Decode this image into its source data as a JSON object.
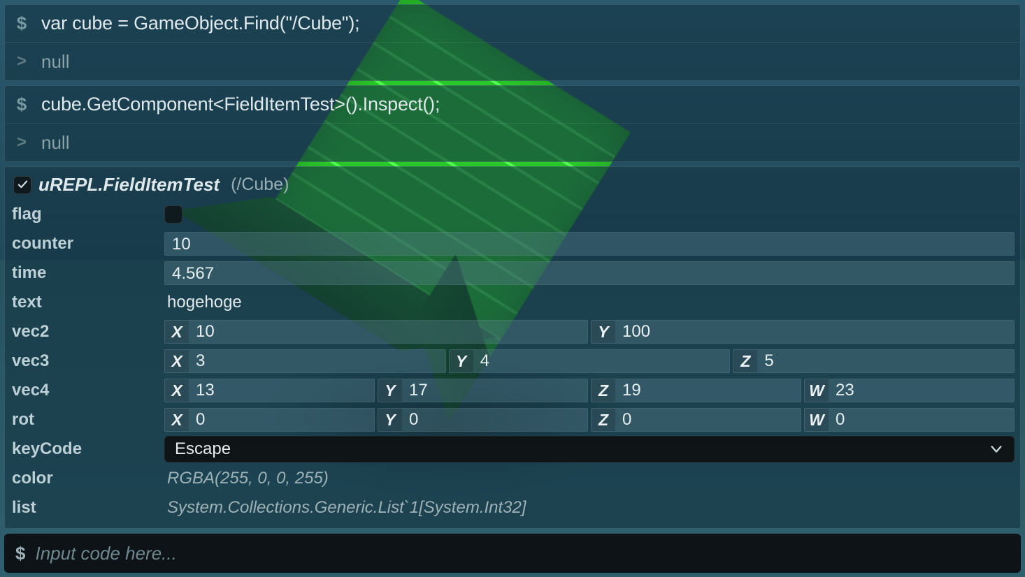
{
  "repl": {
    "entries": [
      {
        "prompt": "$",
        "cmd": "var cube = GameObject.Find(\"/Cube\");",
        "out_prompt": ">",
        "out": "null"
      },
      {
        "prompt": "$",
        "cmd": "cube.GetComponent<FieldItemTest>().Inspect();",
        "out_prompt": ">",
        "out": "null"
      }
    ]
  },
  "inspector": {
    "enabled": true,
    "title": "uREPL.FieldItemTest",
    "path": "(/Cube)",
    "fields": {
      "flag": {
        "label": "flag",
        "value": false
      },
      "counter": {
        "label": "counter",
        "value": "10"
      },
      "time": {
        "label": "time",
        "value": "4.567"
      },
      "text": {
        "label": "text",
        "value": "hogehoge"
      },
      "vec2": {
        "label": "vec2",
        "x": "10",
        "y": "100"
      },
      "vec3": {
        "label": "vec3",
        "x": "3",
        "y": "4",
        "z": "5"
      },
      "vec4": {
        "label": "vec4",
        "x": "13",
        "y": "17",
        "z": "19",
        "w": "23"
      },
      "rot": {
        "label": "rot",
        "x": "0",
        "y": "0",
        "z": "0",
        "w": "0"
      },
      "keyCode": {
        "label": "keyCode",
        "value": "Escape"
      },
      "color": {
        "label": "color",
        "value": "RGBA(255, 0, 0, 255)"
      },
      "list": {
        "label": "list",
        "value": "System.Collections.Generic.List`1[System.Int32]"
      }
    },
    "axis_labels": {
      "x": "X",
      "y": "Y",
      "z": "Z",
      "w": "W"
    }
  },
  "input": {
    "prompt": "$",
    "placeholder": "Input code here..."
  }
}
